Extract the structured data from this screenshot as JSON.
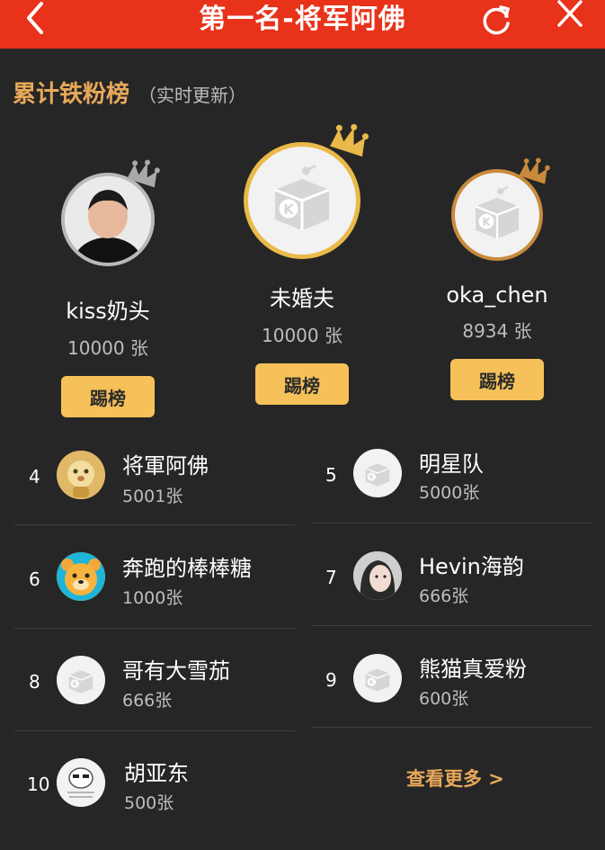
{
  "header": {
    "title": "第一名-将军阿佛",
    "bg_color": "#e8321a"
  },
  "section": {
    "title": "累计铁粉榜",
    "subtitle": "（实时更新）"
  },
  "podium": [
    {
      "rank": 2,
      "name": "kiss奶头",
      "count": "10000 张",
      "button": "踢榜",
      "crown": "silver"
    },
    {
      "rank": 1,
      "name": "未婚夫",
      "count": "10000 张",
      "button": "踢榜",
      "crown": "gold"
    },
    {
      "rank": 3,
      "name": "oka_chen",
      "count": "8934 张",
      "button": "踢榜",
      "crown": "bronze"
    }
  ],
  "ranks": [
    {
      "rank": "4",
      "name": "将軍阿佛",
      "count": "5001张",
      "avatar": "lion-avatar"
    },
    {
      "rank": "5",
      "name": "明星队",
      "count": "5000张",
      "avatar": "default-k-avatar"
    },
    {
      "rank": "6",
      "name": "奔跑的棒棒糖",
      "count": "1000张",
      "avatar": "bear-avatar"
    },
    {
      "rank": "7",
      "name": "Hevin海韵",
      "count": "666张",
      "avatar": "girl-photo-avatar"
    },
    {
      "rank": "8",
      "name": "哥有大雪茄",
      "count": "666张",
      "avatar": "default-k-avatar"
    },
    {
      "rank": "9",
      "name": "熊猫真爱粉",
      "count": "600张",
      "avatar": "default-k-avatar"
    },
    {
      "rank": "10",
      "name": "胡亚东",
      "count": "500张",
      "avatar": "cartoon-avatar"
    }
  ],
  "more_link": "查看更多 >",
  "colors": {
    "background": "#262626",
    "accent": "#e8a85a",
    "button": "#f6c159"
  }
}
